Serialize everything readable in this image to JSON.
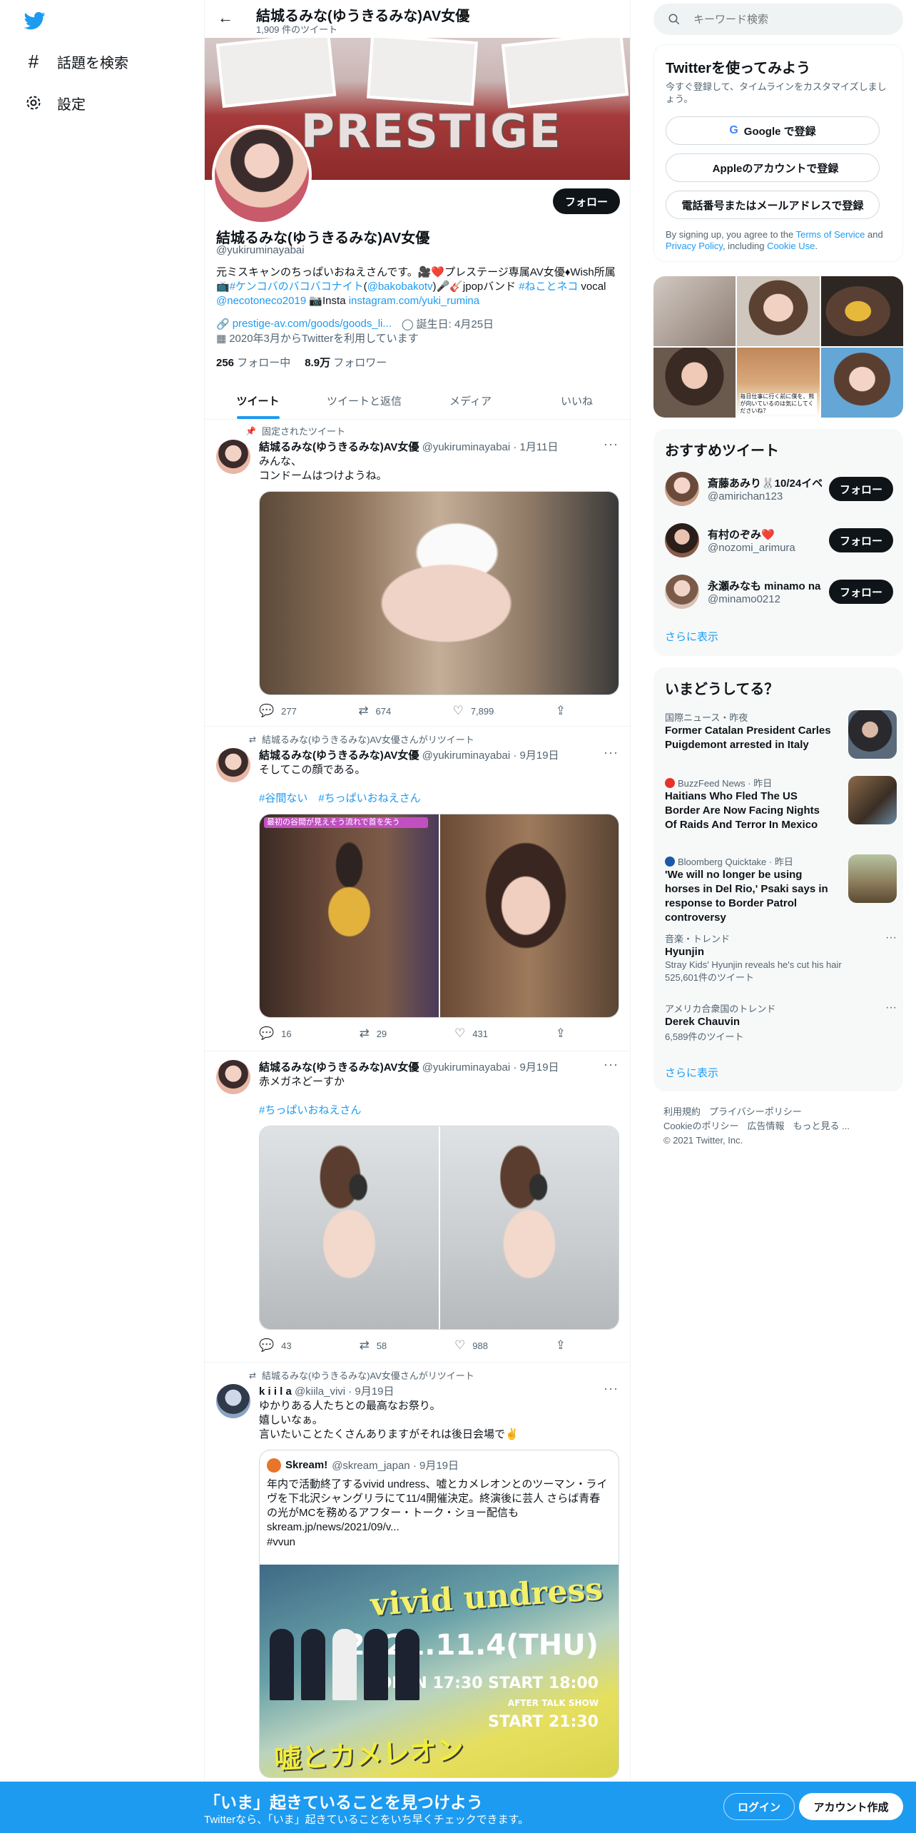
{
  "nav": {
    "items": [
      {
        "label": "話題を検索",
        "icon": "hashtag-icon"
      },
      {
        "label": "設定",
        "icon": "gear-icon"
      }
    ]
  },
  "header": {
    "name": "結城るみな(ゆうきるみな)AV女優",
    "tweet_count": "1,909 件のツイート"
  },
  "banner": {
    "text": "PRESTIGE"
  },
  "profile": {
    "follow_label": "フォロー",
    "name": "結城るみな(ゆうきるみな)AV女優",
    "handle": "@yukiruminayabai",
    "bio_1": "元ミスキャンのちっぱいおねえさんです。🎥❤️プレステージ専属AV女優♦Wish所属",
    "bio_2a": "📺",
    "bio_2b": "#ケンコバのバコバコナイト",
    "bio_2c": "(",
    "bio_2d": "@bakobakotv",
    "bio_2e": ")🎤🎸jpopバンド ",
    "bio_2f": "#ねことネコ",
    "bio_2g": " vocal",
    "bio_3a": "@necotoneco2019",
    "bio_3b": " 📷Insta ",
    "bio_3c": "instagram.com/yuki_rumina",
    "link": "prestige-av.com/goods/goods_li...",
    "birthday": "誕生日: 4月25日",
    "joined": "2020年3月からTwitterを利用しています",
    "following_count": "256",
    "following_label": "フォロー中",
    "followers_count": "8.9万",
    "followers_label": "フォロワー"
  },
  "tabs": [
    "ツイート",
    "ツイートと返信",
    "メディア",
    "いいね"
  ],
  "tweets": [
    {
      "context": "固定されたツイート",
      "name": "結城るみな(ゆうきるみな)AV女優",
      "meta": "@yukiruminayabai · 1月11日",
      "line1": "みんな、",
      "line2": "コンドームはつけようね。",
      "replies": "277",
      "retweets": "674",
      "likes": "7,899"
    },
    {
      "context": "結城るみな(ゆうきるみな)AV女優さんがリツイート",
      "name": "結城るみな(ゆうきるみな)AV女優",
      "meta": "@yukiruminayabai · 9月19日",
      "line1": "そしてこの顔である。",
      "hashtags": "#谷間ない　#ちっぱいおねえさん",
      "media_caption": "最初の谷間が見えそう流れで首を失う",
      "replies": "16",
      "retweets": "29",
      "likes": "431"
    },
    {
      "name": "結城るみな(ゆうきるみな)AV女優",
      "meta": "@yukiruminayabai · 9月19日",
      "line1": "赤メガネどーすか",
      "hashtags": "#ちっぱいおねえさん",
      "replies": "43",
      "retweets": "58",
      "likes": "988"
    },
    {
      "context": "結城るみな(ゆうきるみな)AV女優さんがリツイート",
      "name": "k i i l a",
      "meta": "@kiila_vivi · 9月19日",
      "line1": "ゆかりある人たちとの最高なお祭り。",
      "line2": "嬉しいなぁ。",
      "line3": "言いたいことたくさんありますがそれは後日会場で✌️",
      "quote": {
        "name": "Skream!",
        "meta": "@skream_japan · 9月19日",
        "text": "年内で活動終了するvivid undress、嘘とカメレオンとのツーマン・ライヴを下北沢シャングリラにて11/4開催決定。終演後に芸人 さらば青春の光がMCを務めるアフター・トーク・ショー配信も skream.jp/news/2021/09/v...",
        "tag": "#vvun",
        "poster_title": "vivid undress",
        "poster_date": "2021.11.4(THU)",
        "poster_times": "OPEN 17:30 START 18:00",
        "poster_talk": "AFTER TALK SHOW",
        "poster_talk_time": "START 21:30",
        "poster_band": "嘘とカメレオン"
      }
    }
  ],
  "right": {
    "search_placeholder": "キーワード検索",
    "signup": {
      "title": "Twitterを使ってみよう",
      "desc": "今すぐ登録して、タイムラインをカスタマイズしましょう。",
      "google": "Google で登録",
      "apple": "Appleのアカウントで登録",
      "phone": "電話番号またはメールアドレスで登録",
      "terms_a": "By signing up, you agree to the ",
      "terms_b": "Terms of Service",
      "terms_c": " and ",
      "terms_d": "Privacy Policy",
      "terms_e": ", including ",
      "terms_f": "Cookie Use",
      "terms_g": "."
    },
    "grid_caption": "毎日仕事に行く前に僕を、熊が向いているのは気にしてくださいね？",
    "suggest": {
      "title": "おすすめツイート",
      "users": [
        {
          "name": "斎藤あみり🐰10/24イベ",
          "handle": "@amirichan123",
          "btn": "フォロー"
        },
        {
          "name": "有村のぞみ❤️",
          "handle": "@nozomi_arimura",
          "btn": "フォロー"
        },
        {
          "name": "永瀬みなも minamo na",
          "handle": "@minamo0212",
          "btn": "フォロー"
        }
      ],
      "more": "さらに表示"
    },
    "trends": {
      "title": "いまどうしてる？",
      "items": [
        {
          "meta": "国際ニュース・昨夜",
          "title": "Former Catalan President Carles Puigdemont arrested in Italy"
        },
        {
          "meta": "BuzzFeed News · 昨日",
          "title": "Haitians Who Fled The US Border Are Now Facing Nights Of Raids And Terror In Mexico"
        },
        {
          "meta": "Bloomberg Quicktake · 昨日",
          "title": "'We will no longer be using horses in Del Rio,' Psaki says in response to Border Patrol controversy"
        },
        {
          "meta": "音楽・トレンド",
          "title": "Hyunjin",
          "sub": "Stray Kids' Hyunjin reveals he's cut his hair",
          "count": "525,601件のツイート"
        },
        {
          "meta": "アメリカ合衆国のトレンド",
          "title": "Derek Chauvin",
          "count": "6,589件のツイート"
        }
      ],
      "more": "さらに表示"
    },
    "footer": {
      "l1": "利用規約",
      "l2": "プライバシーポリシー",
      "l3": "Cookieのポリシー",
      "l4": "広告情報",
      "l5": "もっと見る ...",
      "copy": "© 2021 Twitter, Inc."
    }
  },
  "bottom": {
    "title": "「いま」起きていることを見つけよう",
    "sub": "Twitterなら、「いま」起きていることをいち早くチェックできます。",
    "login": "ログイン",
    "signup": "アカウント作成"
  },
  "colors": {
    "accent": "#1d9bf0",
    "text": "#0f1419",
    "muted": "#536471"
  }
}
